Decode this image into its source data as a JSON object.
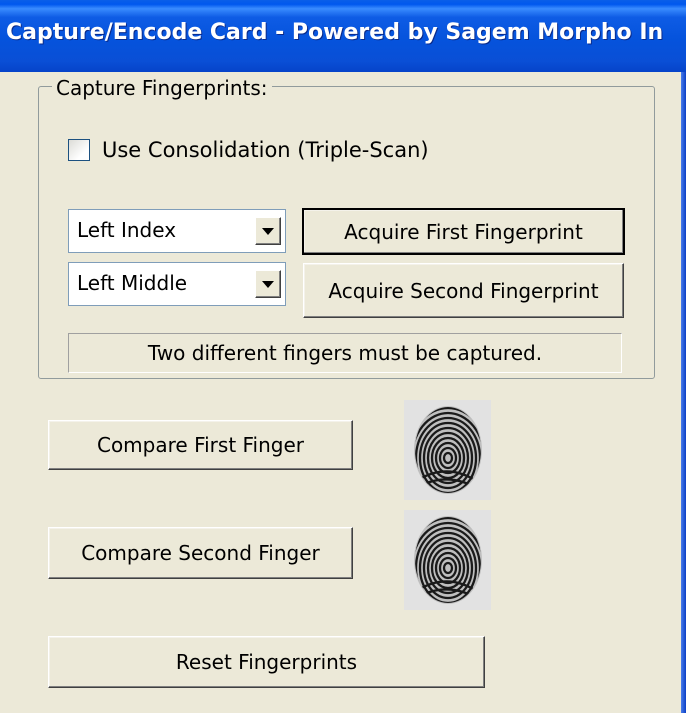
{
  "window": {
    "title": "Capture/Encode Card - Powered by Sagem Morpho In"
  },
  "capture_group": {
    "label": "Capture Fingerprints:",
    "consolidation_checkbox": {
      "label": "Use Consolidation (Triple-Scan)",
      "checked": false
    },
    "first_finger_select": {
      "value": "Left Index"
    },
    "second_finger_select": {
      "value": "Left Middle"
    },
    "acquire_first_label": "Acquire First Fingerprint",
    "acquire_second_label": "Acquire Second Fingerprint",
    "status_text": "Two different fingers must be captured."
  },
  "compare": {
    "first_label": "Compare First Finger",
    "second_label": "Compare Second Finger"
  },
  "reset_label": "Reset Fingerprints",
  "colors": {
    "window_face": "#ECE9D8",
    "title_bar": "#0553DC",
    "groupbox_border": "#919B9C",
    "input_border": "#7F9DB9"
  },
  "icons": {
    "first_preview": "fingerprint-image",
    "second_preview": "fingerprint-image",
    "dropdown": "chevron-down-icon"
  }
}
